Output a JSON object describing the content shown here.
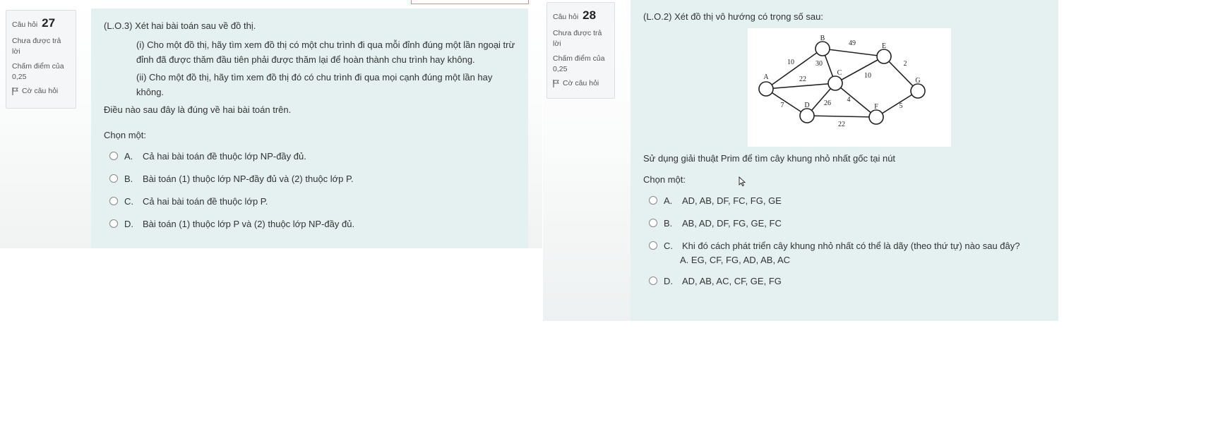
{
  "q27": {
    "label": "Câu hỏi",
    "number": "27",
    "status": "Chưa được trả lời",
    "points": "Chấm điểm của 0,25",
    "flag": "Cờ câu hỏi",
    "title": "(L.O.3) Xét hai bài toán sau về đồ thị.",
    "item1": "(i) Cho một đồ thị, hãy tìm xem đồ thị có một chu trình đi qua mỗi đỉnh đúng một lần ngoại trừ đỉnh đã được thăm đầu tiên phải được thăm lại để hoàn thành chu trình hay không.",
    "item2": "(ii) Cho một đồ thị, hãy tìm xem đồ thị đó có chu trình đi qua mọi cạnh đúng một lần hay không.",
    "question": "Điều nào sau đây là đúng về hai bài toán trên.",
    "choose": "Chọn một:",
    "options": [
      {
        "letter": "A.",
        "text": "Cả hai bài toán đề thuộc lớp NP-đầy đủ."
      },
      {
        "letter": "B.",
        "text": "Bài toán (1) thuộc lớp NP-đầy đủ và (2) thuộc lớp P."
      },
      {
        "letter": "C.",
        "text": "Cả hai bài toán đề thuộc lớp P."
      },
      {
        "letter": "D.",
        "text": "Bài toán (1) thuộc lớp P và (2) thuộc lớp NP-đầy đủ."
      }
    ]
  },
  "q28": {
    "label": "Câu hỏi",
    "number": "28",
    "status": "Chưa được trả lời",
    "points": "Chấm điểm của 0,25",
    "flag": "Cờ câu hỏi",
    "title": "(L.O.2) Xét đồ thị vô hướng có trọng số sau:",
    "question": "Sử dụng giải thuật Prim để tìm cây khung nhỏ nhất gốc tại nút",
    "choose": "Chọn một:",
    "options": [
      {
        "letter": "A.",
        "text": "AD, AB, DF, FC, FG, GE"
      },
      {
        "letter": "B.",
        "text": "AB, AD, DF, FG, GE, FC"
      },
      {
        "letter": "C.",
        "text": "Khi đó cách phát triển cây khung nhỏ nhất có thể là dãy (theo thứ tự) nào sau đây?",
        "sub": "A. EG, CF, FG, AD, AB, AC"
      },
      {
        "letter": "D.",
        "text": "AD, AB, AC, CF, GE, FG"
      }
    ],
    "graph": {
      "nodes": [
        "A",
        "B",
        "C",
        "D",
        "E",
        "F",
        "G"
      ],
      "edges": [
        {
          "u": "A",
          "v": "B",
          "w": "10"
        },
        {
          "u": "A",
          "v": "C",
          "w": "22"
        },
        {
          "u": "A",
          "v": "D",
          "w": "7"
        },
        {
          "u": "B",
          "v": "C",
          "w": "30"
        },
        {
          "u": "B",
          "v": "E",
          "w": "49"
        },
        {
          "u": "C",
          "v": "E",
          "w": "10"
        },
        {
          "u": "C",
          "v": "D",
          "w": "26"
        },
        {
          "u": "C",
          "v": "F",
          "w": "4"
        },
        {
          "u": "D",
          "v": "F",
          "w": "22"
        },
        {
          "u": "E",
          "v": "G",
          "w": "2"
        },
        {
          "u": "F",
          "v": "G",
          "w": "5"
        }
      ]
    }
  }
}
